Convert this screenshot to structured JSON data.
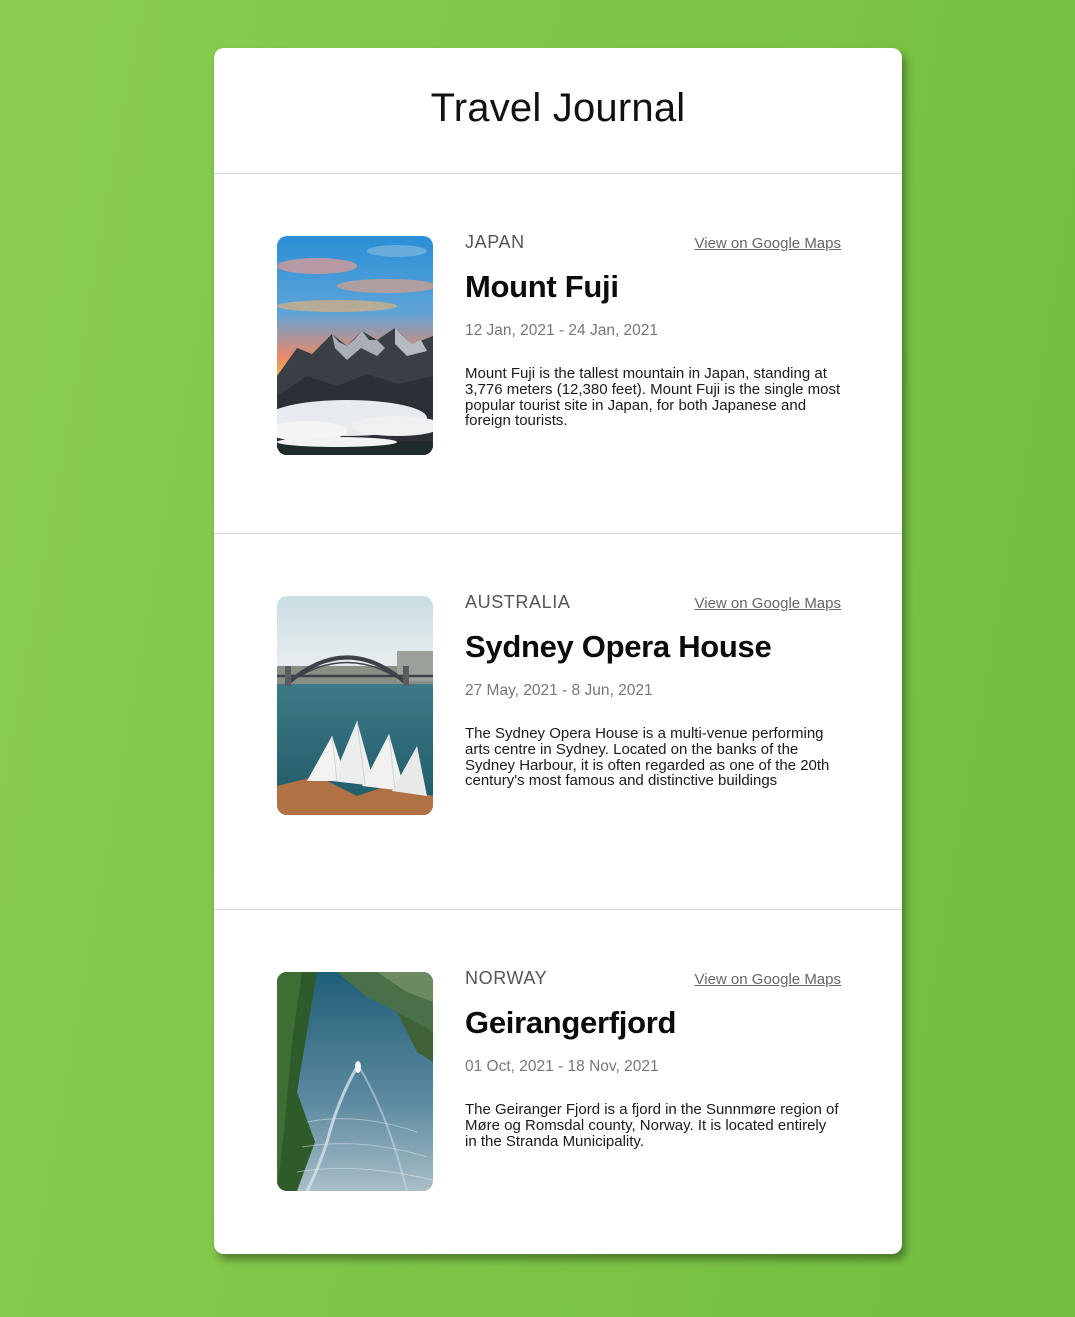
{
  "app": {
    "title": "Travel Journal"
  },
  "entries": [
    {
      "country": "JAPAN",
      "map_link": "View on Google Maps",
      "title": "Mount Fuji",
      "dates": "12 Jan, 2021 - 24 Jan, 2021",
      "description": "Mount Fuji is the tallest mountain in Japan, standing at 3,776 meters (12,380 feet). Mount Fuji is the single most popular tourist site in Japan, for both Japanese and foreign tourists.",
      "image_icon": "mountain-photo"
    },
    {
      "country": "AUSTRALIA",
      "map_link": "View on Google Maps",
      "title": "Sydney Opera House",
      "dates": "27 May, 2021 - 8 Jun, 2021",
      "description": "The Sydney Opera House is a multi-venue performing arts centre in Sydney. Located on the banks of the Sydney Harbour, it is often regarded as one of the 20th century's most famous and distinctive buildings",
      "image_icon": "opera-house-photo"
    },
    {
      "country": "NORWAY",
      "map_link": "View on Google Maps",
      "title": "Geirangerfjord",
      "dates": "01 Oct, 2021 - 18 Nov, 2021",
      "description": "The Geiranger Fjord is a fjord in the Sunnmøre region of Møre og Romsdal county, Norway. It is located entirely in the Stranda Municipality.",
      "image_icon": "fjord-photo"
    }
  ],
  "colors": {
    "background": "#7dc547",
    "card": "#ffffff",
    "divider": "#d8d8d8",
    "muted_text": "#777777"
  }
}
